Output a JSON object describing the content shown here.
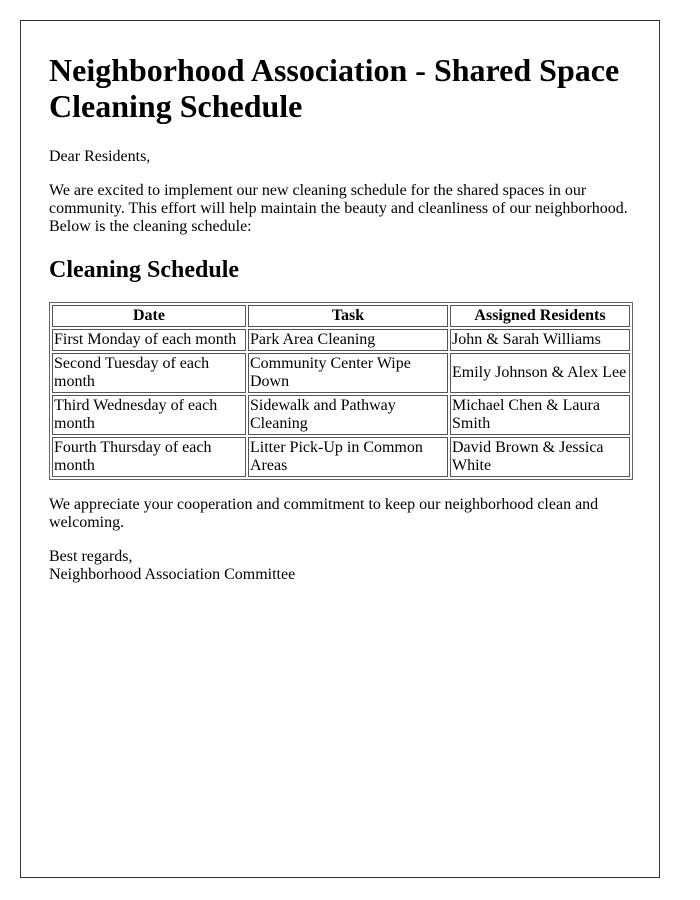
{
  "document": {
    "title": "Neighborhood Association - Shared Space Cleaning Schedule",
    "greeting": "Dear Residents,",
    "intro": "We are excited to implement our new cleaning schedule for the shared spaces in our community. This effort will help maintain the beauty and cleanliness of our neighborhood. Below is the cleaning schedule:",
    "section_heading": "Cleaning Schedule",
    "table": {
      "headers": [
        "Date",
        "Task",
        "Assigned Residents"
      ],
      "rows": [
        [
          "First Monday of each month",
          "Park Area Cleaning",
          "John & Sarah Williams"
        ],
        [
          "Second Tuesday of each month",
          "Community Center Wipe Down",
          "Emily Johnson & Alex Lee"
        ],
        [
          "Third Wednesday of each month",
          "Sidewalk and Pathway Cleaning",
          "Michael Chen & Laura Smith"
        ],
        [
          "Fourth Thursday of each month",
          "Litter Pick-Up in Common Areas",
          "David Brown & Jessica White"
        ]
      ]
    },
    "closing": "We appreciate your cooperation and commitment to keep our neighborhood clean and welcoming.",
    "signoff": "Best regards,",
    "signature": "Neighborhood Association Committee"
  }
}
